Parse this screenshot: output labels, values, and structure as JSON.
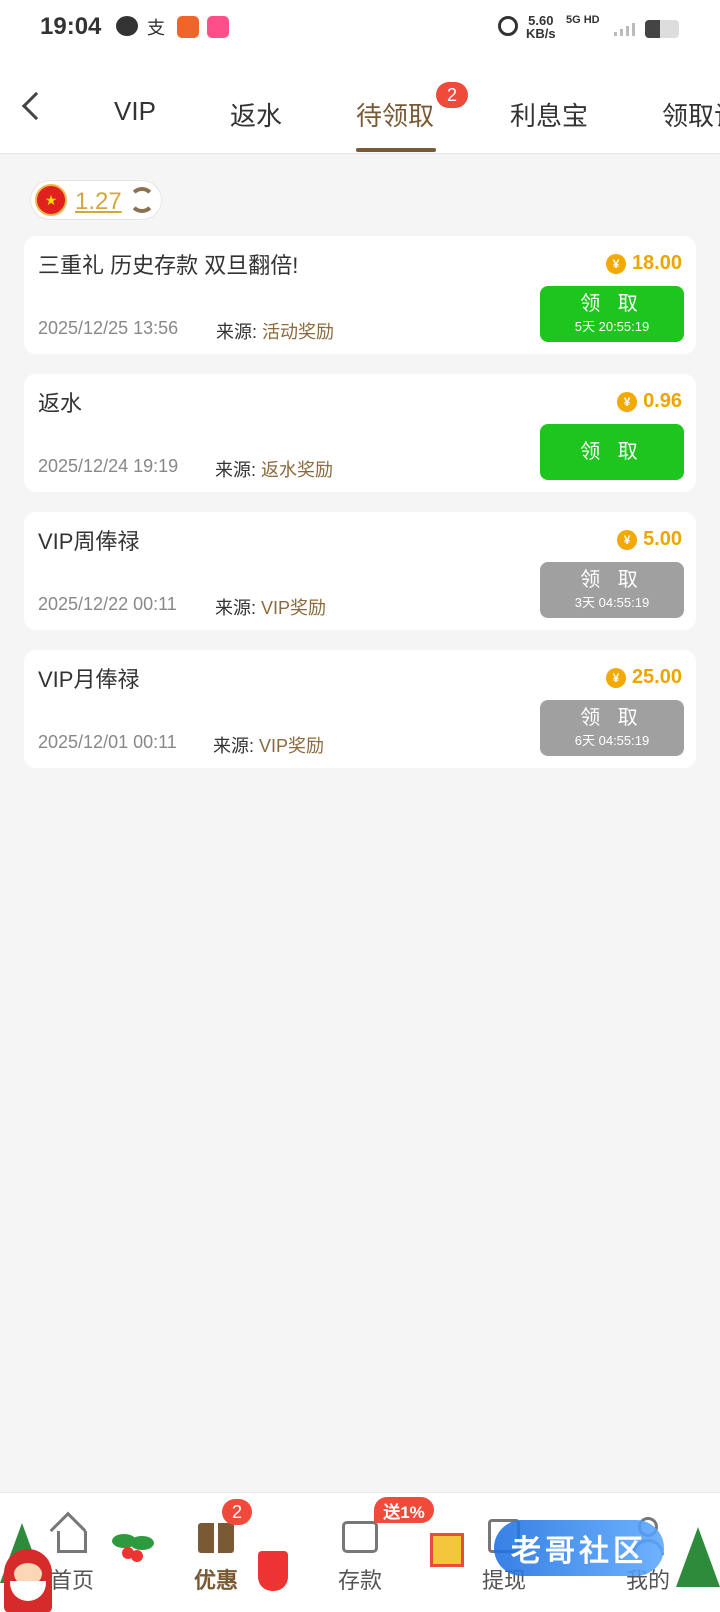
{
  "status_bar": {
    "time": "19:04",
    "speed_value": "5.60",
    "speed_unit": "KB/s",
    "net_type": "5G HD",
    "zhi_icon": "支",
    "battery_level": 0.45
  },
  "tabs": {
    "items": [
      {
        "label": "VIP"
      },
      {
        "label": "返水"
      },
      {
        "label": "待领取"
      },
      {
        "label": "利息宝"
      },
      {
        "label": "领取记"
      }
    ],
    "active_index": 2,
    "badge": "2"
  },
  "balance": {
    "value": "1.27"
  },
  "rewards": [
    {
      "title": "三重礼 历史存款 双旦翻倍!",
      "amount": "18.00",
      "date": "2025/12/25 13:56",
      "source_label": "来源:",
      "source": "活动奖励",
      "button_label": "领 取",
      "countdown": "5天 20:55:19",
      "state": "active"
    },
    {
      "title": "返水",
      "amount": "0.96",
      "date": "2025/12/24 19:19",
      "source_label": "来源:",
      "source": "返水奖励",
      "button_label": "领 取",
      "countdown": "",
      "state": "active"
    },
    {
      "title": "VIP周俸禄",
      "amount": "5.00",
      "date": "2025/12/22 00:11",
      "source_label": "来源:",
      "source": "VIP奖励",
      "button_label": "领 取",
      "countdown": "3天 04:55:19",
      "state": "disabled"
    },
    {
      "title": "VIP月俸禄",
      "amount": "25.00",
      "date": "2025/12/01 00:11",
      "source_label": "来源:",
      "source": "VIP奖励",
      "button_label": "领 取",
      "countdown": "6天 04:55:19",
      "state": "disabled"
    }
  ],
  "coin_symbol": "¥",
  "bottom_nav": {
    "items": [
      {
        "label": "首页",
        "icon": "home-icon"
      },
      {
        "label": "优惠",
        "icon": "gift-icon"
      },
      {
        "label": "存款",
        "icon": "wallet-icon"
      },
      {
        "label": "提现",
        "icon": "withdraw-icon"
      },
      {
        "label": "我的",
        "icon": "user-icon"
      }
    ],
    "active_index": 1,
    "promo_badge": "2",
    "deposit_badge": "送1%"
  },
  "watermark": "老哥社区",
  "colors": {
    "accent": "#7a5a35",
    "green_button": "#1ec51e",
    "gray_button": "#a0a0a0",
    "coin": "#efa500",
    "badge": "#ef4a3a"
  }
}
